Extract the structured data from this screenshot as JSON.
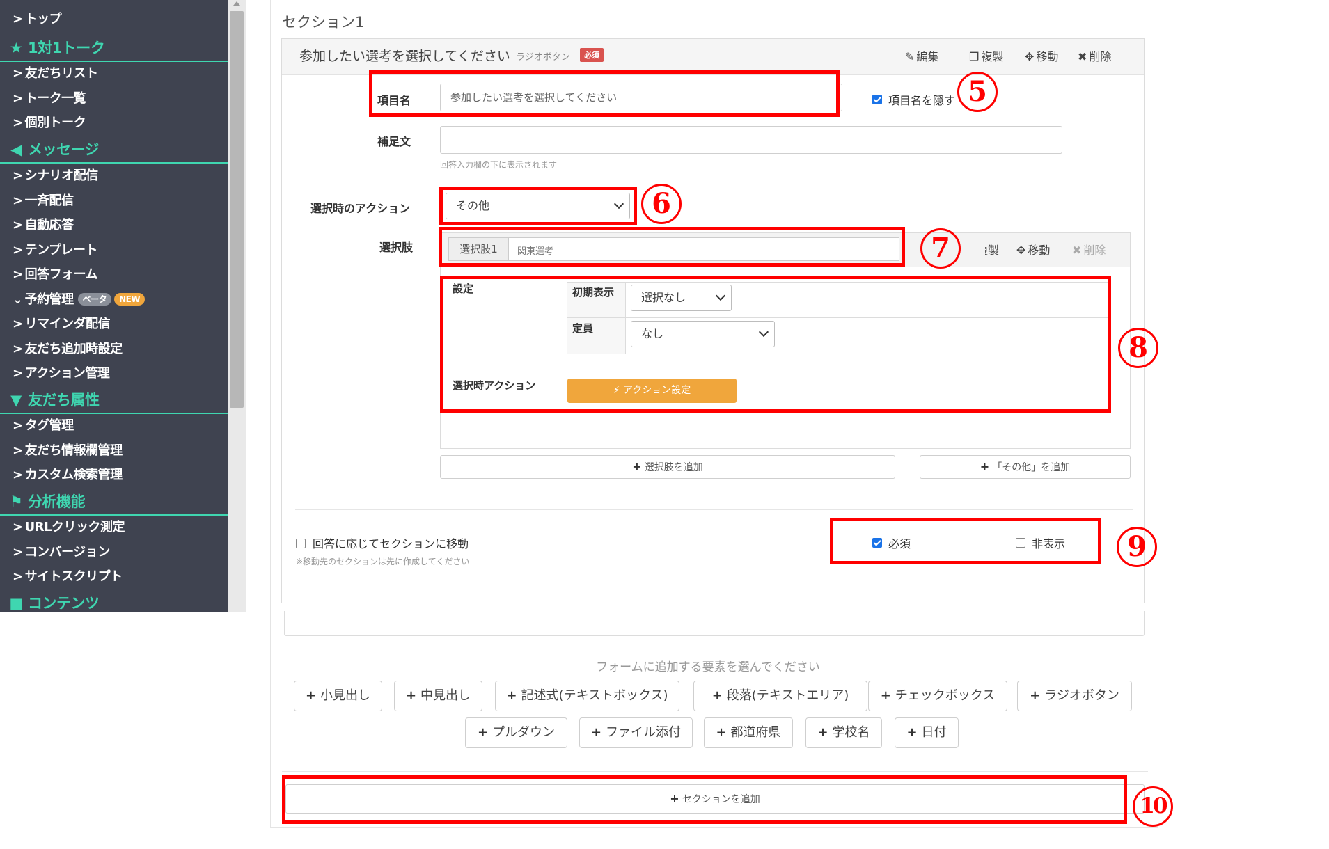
{
  "sidebar": {
    "items": [
      {
        "label": "トップ",
        "type": "link"
      },
      {
        "label": "1対1トーク",
        "type": "head",
        "icon": "star-icon",
        "glyph": "★"
      },
      {
        "label": "友だちリスト",
        "type": "link"
      },
      {
        "label": "トーク一覧",
        "type": "link"
      },
      {
        "label": "個別トーク",
        "type": "link"
      },
      {
        "label": "メッセージ",
        "type": "head",
        "icon": "megaphone-icon",
        "glyph": "📢"
      },
      {
        "label": "シナリオ配信",
        "type": "link"
      },
      {
        "label": "一斉配信",
        "type": "link"
      },
      {
        "label": "自動応答",
        "type": "link"
      },
      {
        "label": "テンプレート",
        "type": "link"
      },
      {
        "label": "回答フォーム",
        "type": "link"
      },
      {
        "label": "予約管理",
        "type": "link",
        "expanded": true,
        "badge_beta": "ベータ",
        "badge_new": "NEW"
      },
      {
        "label": "リマインダ配信",
        "type": "link"
      },
      {
        "label": "友だち追加時設定",
        "type": "link"
      },
      {
        "label": "アクション管理",
        "type": "link"
      },
      {
        "label": "友だち属性",
        "type": "head",
        "icon": "filter-icon",
        "glyph": "▼"
      },
      {
        "label": "タグ管理",
        "type": "link"
      },
      {
        "label": "友だち情報欄管理",
        "type": "link"
      },
      {
        "label": "カスタム検索管理",
        "type": "link"
      },
      {
        "label": "分析機能",
        "type": "head",
        "icon": "flag-icon",
        "glyph": "⚑"
      },
      {
        "label": "URLクリック測定",
        "type": "link"
      },
      {
        "label": "コンバージョン",
        "type": "link"
      },
      {
        "label": "サイトスクリプト",
        "type": "link"
      },
      {
        "label": "コンテンツ",
        "type": "head",
        "icon": "folder-icon",
        "glyph": "📂"
      }
    ],
    "accent_color": "#3fd6b0",
    "background_color": "#3f4350"
  },
  "section": {
    "title": "セクション1",
    "question": {
      "title": "参加したい選考を選択してください",
      "type_label": "ラジオボタン",
      "required_badge": "必須",
      "actions": {
        "edit": "編集",
        "copy": "複製",
        "move": "移動",
        "delete": "削除"
      },
      "item_name_label": "項目名",
      "item_name_value": "参加したい選考を選択してください",
      "hide_item_name_label": "項目名を隠す",
      "hide_item_name_checked": true,
      "supplement_label": "補足文",
      "supplement_value": "",
      "supplement_help": "回答入力欄の下に表示されます",
      "select_action_label": "選択時のアクション",
      "select_action_value": "その他",
      "choices_label": "選択肢",
      "choice": {
        "addon": "選択肢1",
        "value": "関東選考",
        "action_copy": "複製",
        "action_move": "移動",
        "action_delete": "削除",
        "settings_label": "設定",
        "initial_display_label": "初期表示",
        "initial_display_value": "選択なし",
        "capacity_label": "定員",
        "capacity_value": "なし",
        "select_action_label": "選択時アクション",
        "action_button": "アクション設定"
      },
      "add_choice_button": "選択肢を追加",
      "add_other_button": "「その他」を追加",
      "jump_section_label": "回答に応じてセクションに移動",
      "jump_section_checked": false,
      "jump_section_note": "※移動先のセクションは先に作成してください",
      "required_label": "必須",
      "required_checked": true,
      "hidden_label": "非表示",
      "hidden_checked": false
    }
  },
  "add_element": {
    "prompt": "フォームに追加する要素を選んでください",
    "buttons": [
      "小見出し",
      "中見出し",
      "記述式(テキストボックス)",
      "段落(テキストエリア)",
      "チェックボックス",
      "ラジオボタン",
      "プルダウン",
      "ファイル添付",
      "都道府県",
      "学校名",
      "日付"
    ]
  },
  "add_section_button": "セクションを追加",
  "annotations": {
    "labels": [
      "5",
      "6",
      "7",
      "8",
      "9",
      "10"
    ],
    "color": "#ff0000"
  }
}
